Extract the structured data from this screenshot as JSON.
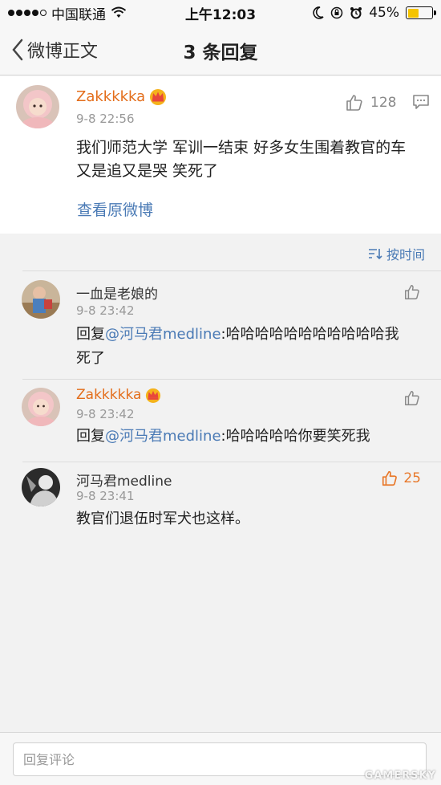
{
  "status_bar": {
    "carrier": "中国联通",
    "time": "上午12:03",
    "battery": "45%",
    "battery_level": 0.45
  },
  "nav": {
    "back_label": "微博正文",
    "title": "3 条回复"
  },
  "post": {
    "username": "Zakkkkka",
    "time": "9-8 22:56",
    "text": "我们师范大学 军训一结束 好多女生围着教官的车又是追又是哭 笑死了",
    "likes": "128",
    "view_original": "查看原微博"
  },
  "sort": {
    "label": "按时间"
  },
  "replies": [
    {
      "username": "一血是老娘的",
      "time": "9-8 23:42",
      "prefix": "回复",
      "mention": "@河马君medline",
      "text": ":哈哈哈哈哈哈哈哈哈哈哈我死了",
      "likes": ""
    },
    {
      "username": "Zakkkkka",
      "time": "9-8 23:42",
      "prefix": "回复",
      "mention": "@河马君medline",
      "text": ":哈哈哈哈哈你要笑死我",
      "likes": ""
    },
    {
      "username": "河马君medline",
      "time": "9-8 23:41",
      "prefix": "",
      "mention": "",
      "text": "教官们退伍时军犬也这样。",
      "likes": "25"
    }
  ],
  "input": {
    "placeholder": "回复评论"
  },
  "watermark": "GAMERSKY",
  "colors": {
    "accent_link": "#4a7ab5",
    "vip_name": "#e36d1a",
    "liked": "#e8782a"
  }
}
